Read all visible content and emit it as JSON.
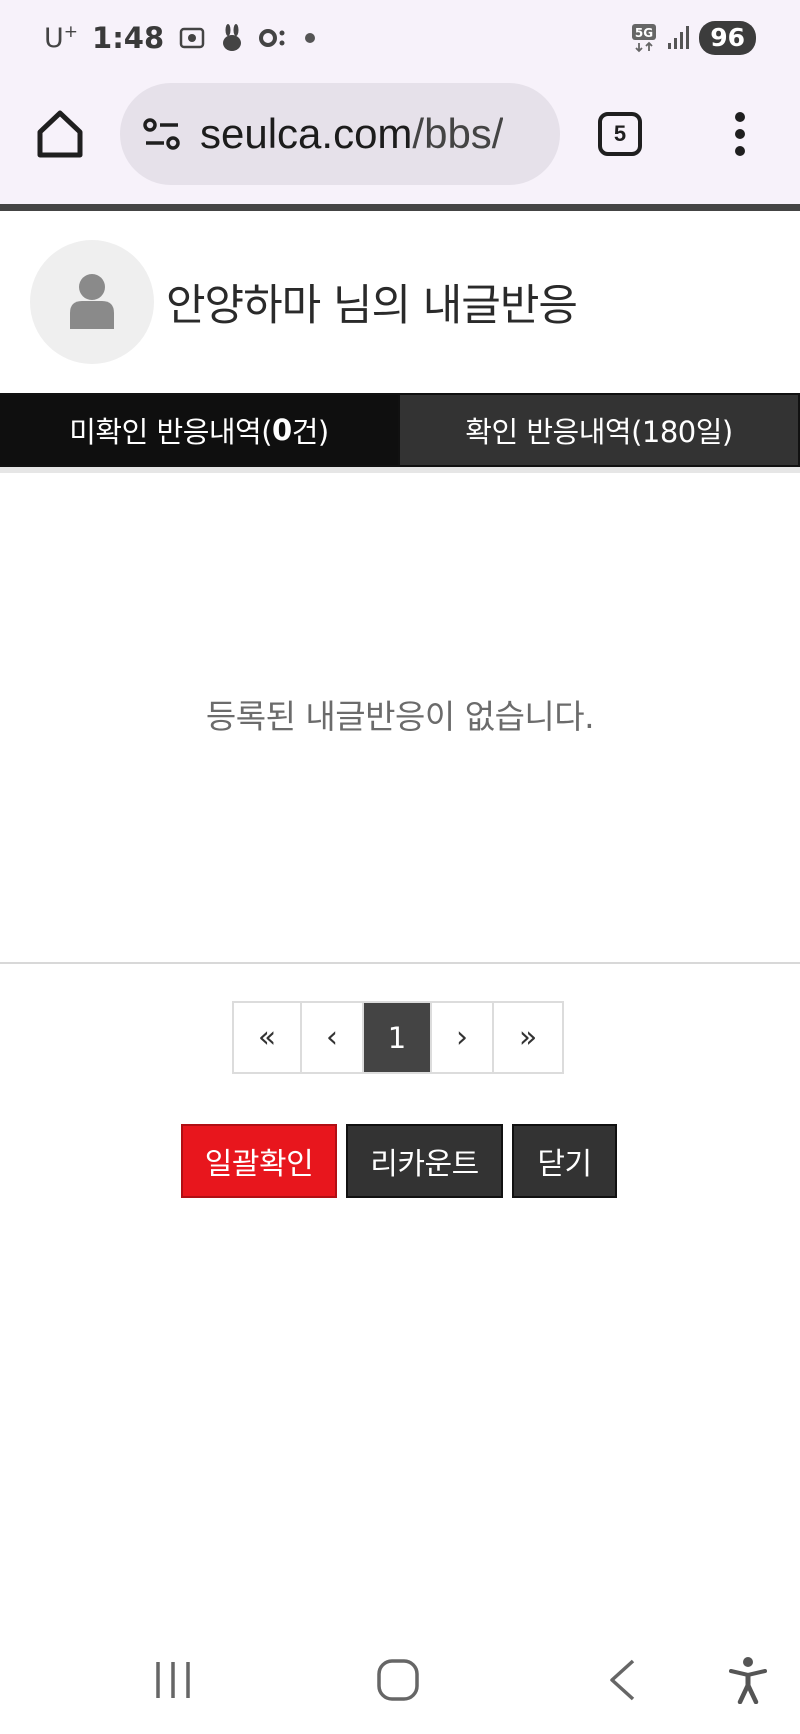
{
  "status_bar": {
    "carrier": "U",
    "carrier_sup": "+",
    "time": "1:48",
    "network": "5G",
    "battery": "96"
  },
  "browser": {
    "url_host": "seulca.com",
    "url_path": "/bbs/",
    "tab_count": "5"
  },
  "page": {
    "title": "안양하마 님의 내글반응",
    "tabs": {
      "unconfirmed_prefix": "미확인 반응내역(",
      "unconfirmed_count": "0",
      "unconfirmed_suffix": "건)",
      "confirmed_label": "확인 반응내역(180일)"
    },
    "empty_message": "등록된 내글반응이 없습니다.",
    "pagination": {
      "first": "«",
      "prev": "‹",
      "current": "1",
      "next": "›",
      "last": "»"
    },
    "buttons": {
      "confirm_all": "일괄확인",
      "recount": "리카운트",
      "close": "닫기"
    }
  },
  "colors": {
    "accent_red": "#e8161d",
    "dark_button": "#333333",
    "active_tab": "#0f0f0f",
    "status_bar_bg": "#f7f2fa"
  },
  "icons": {
    "home": "home-icon",
    "site_info": "tune-icon",
    "menu": "more-vert-icon",
    "avatar": "user-silhouette-icon",
    "nav_recents": "recents-icon",
    "nav_home": "nav-home-icon",
    "nav_back": "back-icon",
    "nav_accessibility": "accessibility-icon"
  }
}
